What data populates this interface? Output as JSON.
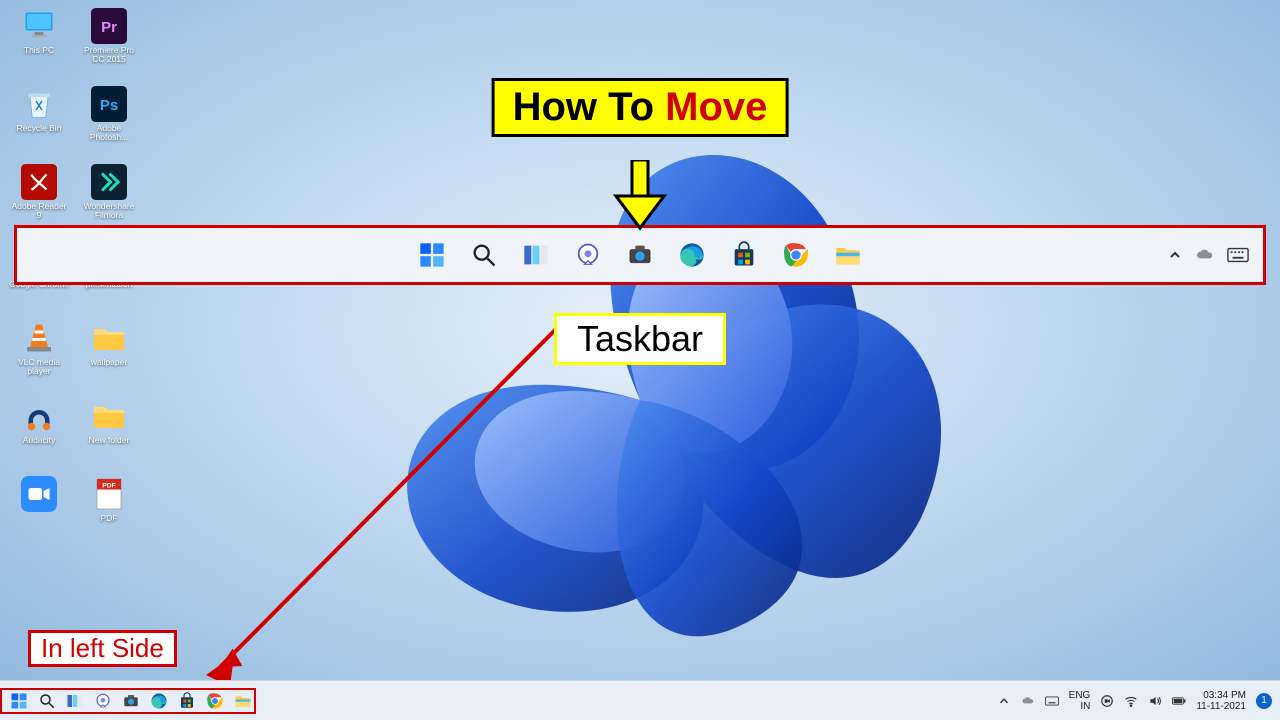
{
  "desktop_icons": [
    {
      "key": "this-pc",
      "label": "This PC"
    },
    {
      "key": "premiere",
      "label": "Premiere Pro CC 2015"
    },
    {
      "key": "recycle",
      "label": "Recycle Bin"
    },
    {
      "key": "photoshop",
      "label": "Adobe Photosh..."
    },
    {
      "key": "adobe-reader",
      "label": "Adobe Reader 9"
    },
    {
      "key": "filmora",
      "label": "Wondershare Filmora"
    },
    {
      "key": "chrome",
      "label": "Google Chrome"
    },
    {
      "key": "presentation",
      "label": "presentation"
    },
    {
      "key": "vlc",
      "label": "VLC media player"
    },
    {
      "key": "wallpaper",
      "label": "wallpaper"
    },
    {
      "key": "audacity",
      "label": "Audacity"
    },
    {
      "key": "newfolder",
      "label": "New folder"
    },
    {
      "key": "zoom",
      "label": ""
    },
    {
      "key": "pdf",
      "label": "PDF"
    }
  ],
  "callouts": {
    "title_part1": "How To ",
    "title_part2": "Move",
    "taskbar_label": "Taskbar",
    "leftside_label": "In left Side"
  },
  "taskbar_apps": [
    {
      "key": "start",
      "name": "start-icon"
    },
    {
      "key": "search",
      "name": "search-icon"
    },
    {
      "key": "taskview",
      "name": "task-view-icon"
    },
    {
      "key": "chat",
      "name": "chat-icon"
    },
    {
      "key": "camera",
      "name": "camera-icon"
    },
    {
      "key": "edge",
      "name": "edge-icon"
    },
    {
      "key": "store",
      "name": "store-icon"
    },
    {
      "key": "chrome",
      "name": "chrome-icon"
    },
    {
      "key": "explorer",
      "name": "file-explorer-icon"
    }
  ],
  "center_tray": [
    {
      "key": "chevron",
      "name": "chevron-up-icon"
    },
    {
      "key": "onedrive",
      "name": "onedrive-icon"
    },
    {
      "key": "keyboard",
      "name": "touch-keyboard-icon"
    }
  ],
  "systray": {
    "chevron": "chevron-up-icon",
    "onedrive": "onedrive-icon",
    "keyboard": "touch-keyboard-icon",
    "lang_top": "ENG",
    "lang_bottom": "IN",
    "wifi": "wifi-icon",
    "sound": "sound-icon",
    "battery": "battery-icon",
    "time": "03:34 PM",
    "date": "11-11-2021",
    "notif_count": "1"
  }
}
